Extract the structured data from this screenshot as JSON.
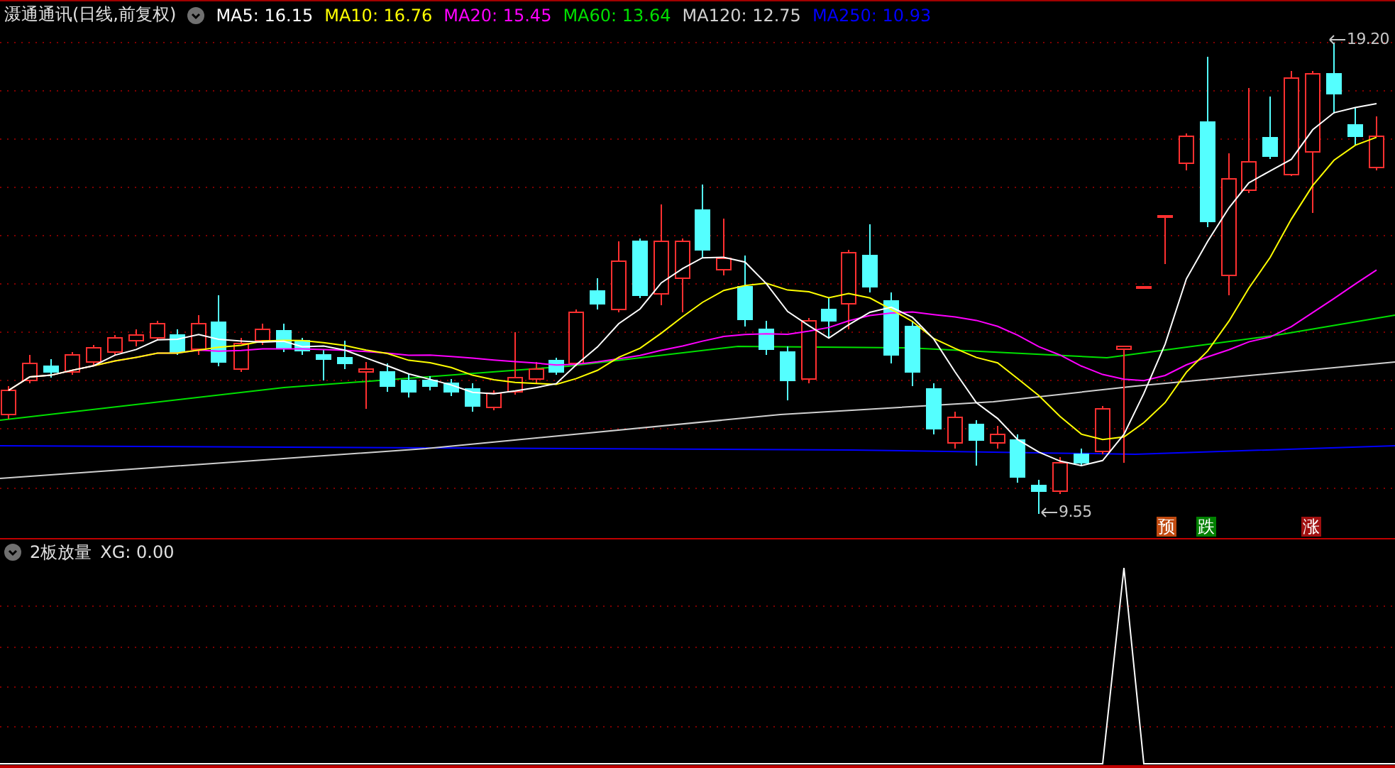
{
  "title": "滠通通讯(日线,前复权)",
  "indicators": [
    {
      "label": "MA5: 16.15",
      "color": "#ffffff"
    },
    {
      "label": "MA10: 16.76",
      "color": "#ffff00"
    },
    {
      "label": "MA20: 15.45",
      "color": "#ff00ff"
    },
    {
      "label": "MA60: 13.64",
      "color": "#00e000"
    },
    {
      "label": "MA120: 12.75",
      "color": "#d0d0d0"
    },
    {
      "label": "MA250: 10.93",
      "color": "#0000ff"
    }
  ],
  "price_marks": {
    "high": "19.20",
    "low": "9.55"
  },
  "signals": [
    {
      "text": "预",
      "color": "#c04a10"
    },
    {
      "text": "跌",
      "color": "#008000"
    },
    {
      "text": "涨",
      "color": "#a01010"
    }
  ],
  "sub_panel": {
    "title": "2板放量",
    "reading": "XG: 0.00"
  }
}
